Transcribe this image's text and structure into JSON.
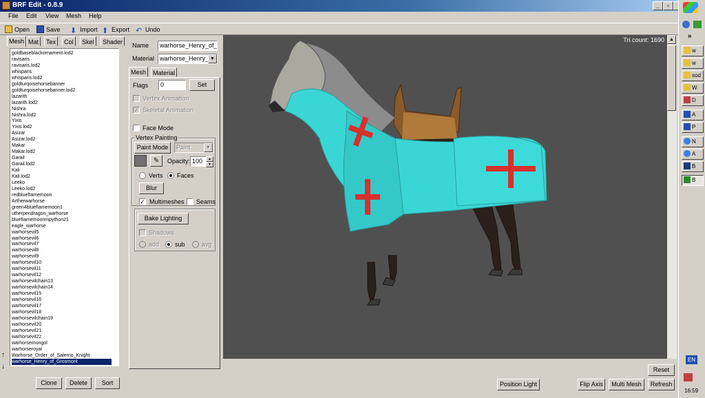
{
  "window": {
    "title": "BRF Edit - 0.8.9"
  },
  "menu": [
    "File",
    "Edit",
    "View",
    "Mesh",
    "Help"
  ],
  "toolbar": {
    "open": "Open",
    "save": "Save",
    "import": "Import",
    "export": "Export",
    "undo": "Undo"
  },
  "left_tabs": [
    "Mesh",
    "Mat",
    "Tex",
    "Col",
    "Skel",
    "Shader"
  ],
  "list_items": [
    "goldbaseblackornament.lod2",
    "ravisaris",
    "ravisaris.lod2",
    "whisparis",
    "whisparis.lod2",
    "goldturqoisehorsebanner",
    "goldturqoisehorsebanner.lod2",
    "lazarith",
    "lazarith.lod2",
    "Nishra",
    "Nishra.lod2",
    "Yixis",
    "Yixis.lod2",
    "Asizar",
    "Asizar.lod2",
    "Makar",
    "Makar.lod2",
    "Garail",
    "Garail.lod2",
    "Kali",
    "Kali.lod2",
    "Leeko",
    "Leeko.lod2",
    "redbluefIamemoon",
    "Artherwarhorse",
    "green4bluefIamemoon1",
    "utherpendragon_warhorse",
    "bluefIamemoonmpython21",
    "eagle_warhorse",
    "warhorsevil5",
    "warhorsevil6",
    "warhorsevil7",
    "warhorsevil8",
    "warhorsevil9",
    "warhorsevil10",
    "warhorsevil11",
    "warhorsevil12",
    "warhorsevilchain13",
    "warhorsevilchain14",
    "warhorsevil15",
    "warhorsevil16",
    "warhorsevil17",
    "warhorsevil18",
    "warhorsevilchain19",
    "warhorsevil20",
    "warhorsevil21",
    "warhorsevil22",
    "warhorsemongol",
    "warhorseroyal",
    "Warhorse_Order_of_Salerno_Knight",
    "warhorse_Henry_of_Grosmont"
  ],
  "selected_item": "warhorse_Henry_of_Grosmont",
  "list_buttons": {
    "clone": "Clone",
    "delete": "Delete",
    "sort": "Sort"
  },
  "props": {
    "name_label": "Name",
    "name_value": "warhorse_Henry_of_Gr",
    "material_label": "Material",
    "material_value": "warhorse_Henry_of",
    "tabs": [
      "Mesh",
      "Material"
    ],
    "flags_label": "Flags",
    "flags_value": "0",
    "set_button": "Set",
    "vertex_animation": "Vertex Animation",
    "skeletal_animation": "Skeletal Animation",
    "face_mode": "Face Mode",
    "vertex_painting": "Vertex Painting",
    "paint_mode": "Paint Mode",
    "paint_select": "Paint",
    "opacity_label": "Opacity:",
    "opacity_value": "100",
    "verts": "Verts",
    "faces": "Faces",
    "blur": "Blur",
    "multimeshes": "Multimeshes",
    "seams": "Seams",
    "bake_lighting": "Bake Lighting",
    "shadows": "Shadows",
    "add": "add",
    "sub": "sub",
    "avg": "avg"
  },
  "viewport": {
    "tri_count": "Tri count: 1690"
  },
  "bottom_buttons": {
    "position_light": "Position Light",
    "flip_axis": "Flip Axis",
    "multi_mesh": "Multi Mesh",
    "refresh": "Refresh",
    "reset": "Reset"
  },
  "taskbar": {
    "items": [
      "w",
      "w",
      "sod",
      "W",
      "D",
      "A",
      "P",
      "N",
      "A",
      "B"
    ],
    "chevron": "»",
    "lang": "EN",
    "clock": "16:59"
  },
  "colors": {
    "horse_cloth": "#3ad6d6",
    "cross": "#d8302c",
    "viewport_bg": "#505050",
    "selection": "#0a246a"
  }
}
